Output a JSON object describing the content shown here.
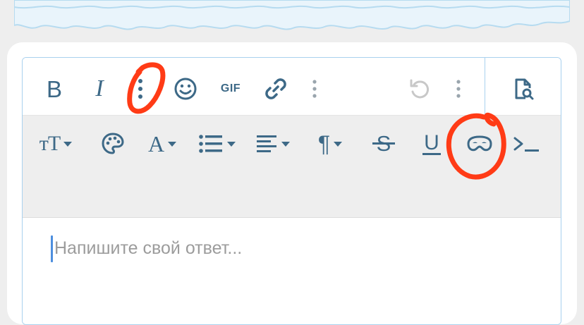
{
  "toolbar": {
    "bold": {
      "label": "B",
      "icon": "bold-icon"
    },
    "italic": {
      "label": "I",
      "icon": "italic-icon"
    },
    "more_vertical_1": {
      "icon": "more-vertical-icon"
    },
    "emoji": {
      "icon": "smiley-icon"
    },
    "gif": {
      "label": "GIF",
      "icon": "gif-icon"
    },
    "link": {
      "icon": "link-icon"
    },
    "more_vertical_2": {
      "icon": "more-vertical-icon"
    },
    "undo": {
      "icon": "undo-icon",
      "disabled": true
    },
    "more_vertical_3": {
      "icon": "more-vertical-icon"
    },
    "preview": {
      "icon": "file-search-icon"
    }
  },
  "toolbar2": {
    "font_size": {
      "label": "тТ",
      "icon": "font-size-icon"
    },
    "palette": {
      "icon": "palette-icon"
    },
    "text_color": {
      "label": "A",
      "icon": "text-color-icon"
    },
    "list": {
      "icon": "list-icon"
    },
    "align": {
      "icon": "align-left-icon"
    },
    "paragraph": {
      "label": "¶",
      "icon": "paragraph-icon"
    },
    "strikethrough": {
      "label": "S",
      "icon": "strikethrough-icon"
    },
    "underline": {
      "label": "U",
      "icon": "underline-icon"
    },
    "spoiler": {
      "icon": "spoiler-mask-icon"
    },
    "code": {
      "label": ">_",
      "icon": "code-icon"
    }
  },
  "editor": {
    "placeholder": "Напишите свой ответ..."
  },
  "colors": {
    "icon": "#3d6987",
    "border": "#a9d1ee",
    "annotation": "#ff3b16",
    "toolbar_bg": "#eeeeee"
  }
}
